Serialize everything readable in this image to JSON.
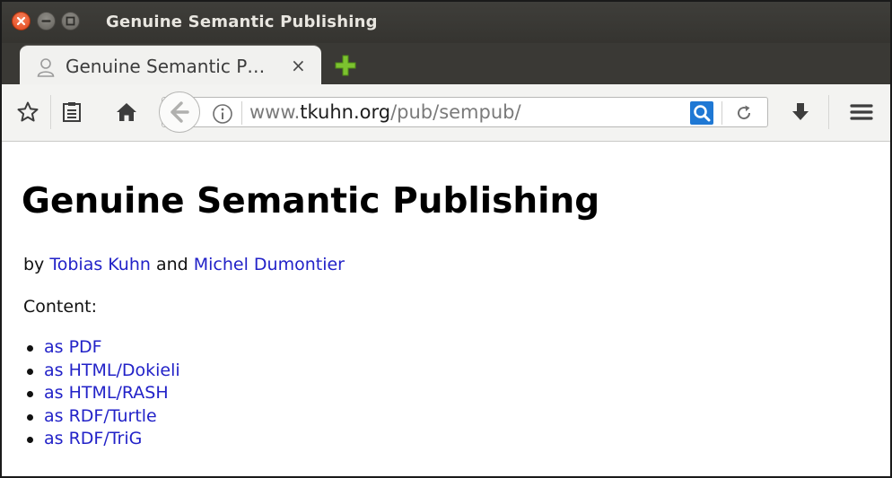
{
  "window": {
    "title": "Genuine Semantic Publishing"
  },
  "tab": {
    "title": "Genuine Semantic P…",
    "close_glyph": "×",
    "icon": "person-icon"
  },
  "toolbar": {
    "icons": [
      "star-icon",
      "reading-list-icon",
      "home-icon",
      "back-icon",
      "info-icon",
      "search-icon",
      "reload-icon",
      "download-icon",
      "menu-icon"
    ]
  },
  "address_bar": {
    "prefix": "www.",
    "domain": "tkuhn.org",
    "path": "/pub/sempub/"
  },
  "page": {
    "title": "Genuine Semantic Publishing",
    "byline_prefix": "by ",
    "authors": [
      "Tobias Kuhn",
      "Michel Dumontier"
    ],
    "byline_joiner": " and ",
    "content_label": "Content:",
    "formats": [
      {
        "label": "as PDF"
      },
      {
        "label": "as HTML/Dokieli"
      },
      {
        "label": "as HTML/RASH"
      },
      {
        "label": "as RDF/Turtle"
      },
      {
        "label": "as RDF/TriG"
      }
    ]
  },
  "colors": {
    "link": "#2222c8",
    "titlebar": "#3f3e3a",
    "close_button": "#e1461b",
    "search_accent": "#1f78d4",
    "newtab_plus": "#7cc22f"
  }
}
